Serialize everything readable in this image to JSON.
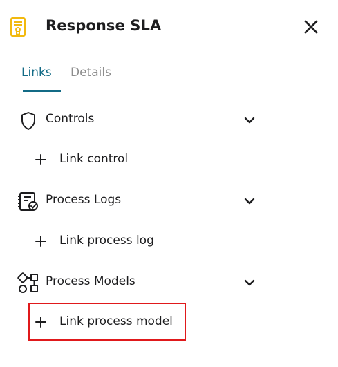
{
  "header": {
    "title": "Response SLA",
    "icon": "certificate-document-icon",
    "close_icon": "close-icon"
  },
  "tabs": [
    {
      "label": "Links",
      "active": true
    },
    {
      "label": "Details",
      "active": false
    }
  ],
  "sections": [
    {
      "label": "Controls",
      "icon": "shield-icon",
      "link_label": "Link control",
      "expanded": true
    },
    {
      "label": "Process Logs",
      "icon": "log-checklist-icon",
      "link_label": "Link process log",
      "expanded": true
    },
    {
      "label": "Process Models",
      "icon": "process-model-shapes-icon",
      "link_label": "Link process model",
      "expanded": true
    }
  ],
  "colors": {
    "accent": "#136b86",
    "icon_yellow": "#f2b90f",
    "highlight": "#e0191b"
  }
}
